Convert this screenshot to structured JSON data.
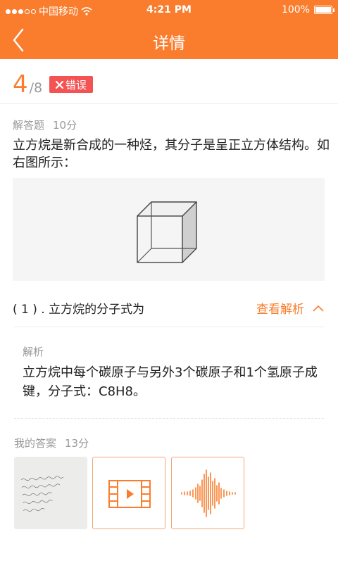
{
  "status_bar": {
    "carrier": "中国移动",
    "time": "4:21 PM",
    "battery": "100%"
  },
  "header": {
    "title": "详情"
  },
  "progress": {
    "current": "4",
    "total": "/8"
  },
  "result_badge": {
    "label": "错误"
  },
  "question": {
    "type": "解答题",
    "score": "10分",
    "text": "立方烷是新合成的一种烃，其分子是呈正立方体结构。如右图所示：",
    "sub_question": "( 1 ) . 立方烷的分子式为",
    "toggle_label": "查看解析"
  },
  "analysis": {
    "label": "解析",
    "text": "立方烷中每个碳原子与另外3个碳原子和1个氢原子成键，分子式：C8H8。"
  },
  "my_answer": {
    "label": "我的答案",
    "score": "13分"
  },
  "colors": {
    "accent": "#fa7d2d",
    "error": "#f35353"
  }
}
